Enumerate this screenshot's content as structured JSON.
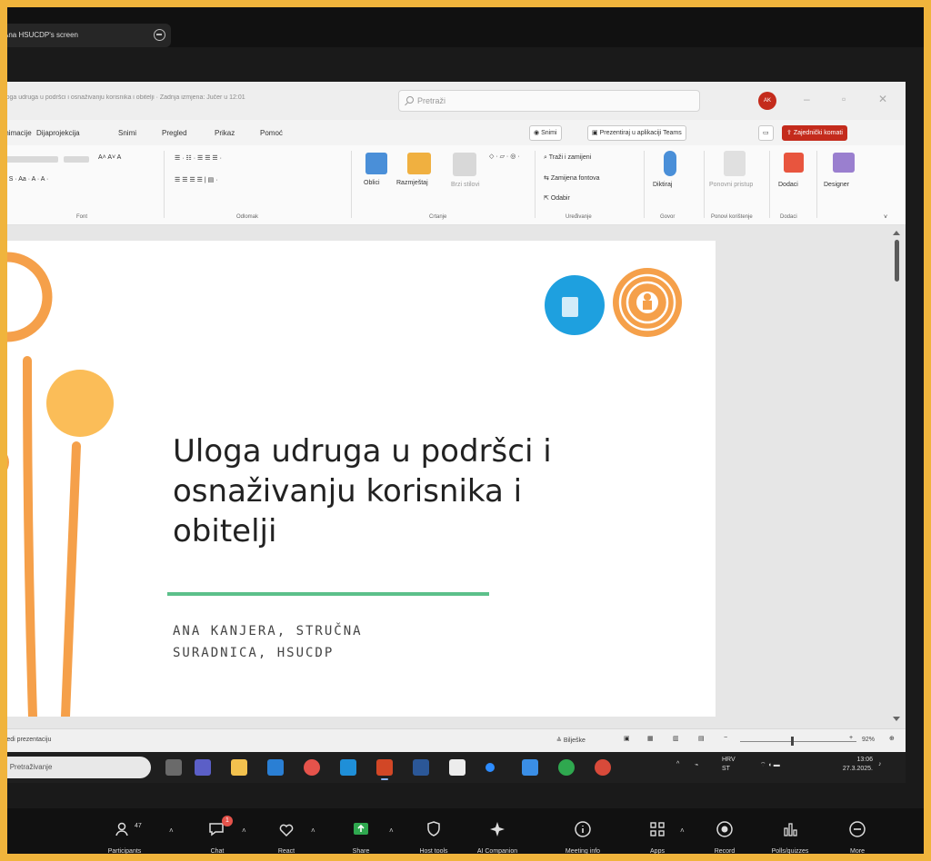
{
  "share_bar": {
    "presenter_label": "Ana HSUCDP's screen"
  },
  "ppt": {
    "document_title": "Uloga udruga u podršci i osnaživanju korisnika i obitelji  ·  Zadnja izmjena: Jučer u 12:01",
    "search_placeholder": "Pretraži",
    "avatar_initials": "AK",
    "menu": [
      "Animacije",
      "Dijaprojekcija",
      "Snimi",
      "Pregled",
      "Prikaz",
      "Pomoć"
    ],
    "menu_buttons": {
      "record": "Snimi",
      "present_teams": "Prezentiraj u aplikaciji Teams",
      "comments": "Zajednički komati"
    },
    "ribbon": {
      "groups": {
        "font": "Font",
        "paragraph": "Odlomak",
        "drawing": "Crtanje",
        "editing": "Uređivanje",
        "voice": "Govor",
        "reuse": "Ponovi korištenje",
        "addins": "Dodaci"
      },
      "labels": {
        "shapes": "Oblici",
        "arrange": "Razmještaj",
        "quick_styles": "Brzi stilovi",
        "find": "Traži i zamijeni",
        "replace_fonts": "Zamijena fontova",
        "select": "Odabir",
        "dictate": "Diktiraj",
        "reuse_slides": "Ponovni pristup",
        "addins": "Dodaci",
        "designer": "Designer"
      }
    },
    "slide": {
      "title": "Uloga udruga u podršci i osnaživanju korisnika i obitelji",
      "author_line1": "ANA KANJERA, STRUČNA",
      "author_line2": "SURADNICA, HSUCDP",
      "colors": {
        "orange": "#f5a04a",
        "yellow": "#fbbd58",
        "green": "#5cc08a",
        "blue": "#1ea0df"
      }
    },
    "status": {
      "left": "Uredi prezentaciju",
      "notes": "Bilješke",
      "zoom": "92%"
    }
  },
  "taskbar": {
    "search": "Pretraživanje",
    "lang_top": "HRV",
    "lang_bottom": "ST",
    "time": "13:06",
    "date": "27.3.2025."
  },
  "zoom": {
    "participants_count": "47",
    "chat_badge": "1",
    "buttons": [
      "Participants",
      "Chat",
      "React",
      "Share",
      "Host tools",
      "AI Companion",
      "Meeting info",
      "Apps",
      "Record",
      "Polls/quizzes",
      "More"
    ]
  }
}
